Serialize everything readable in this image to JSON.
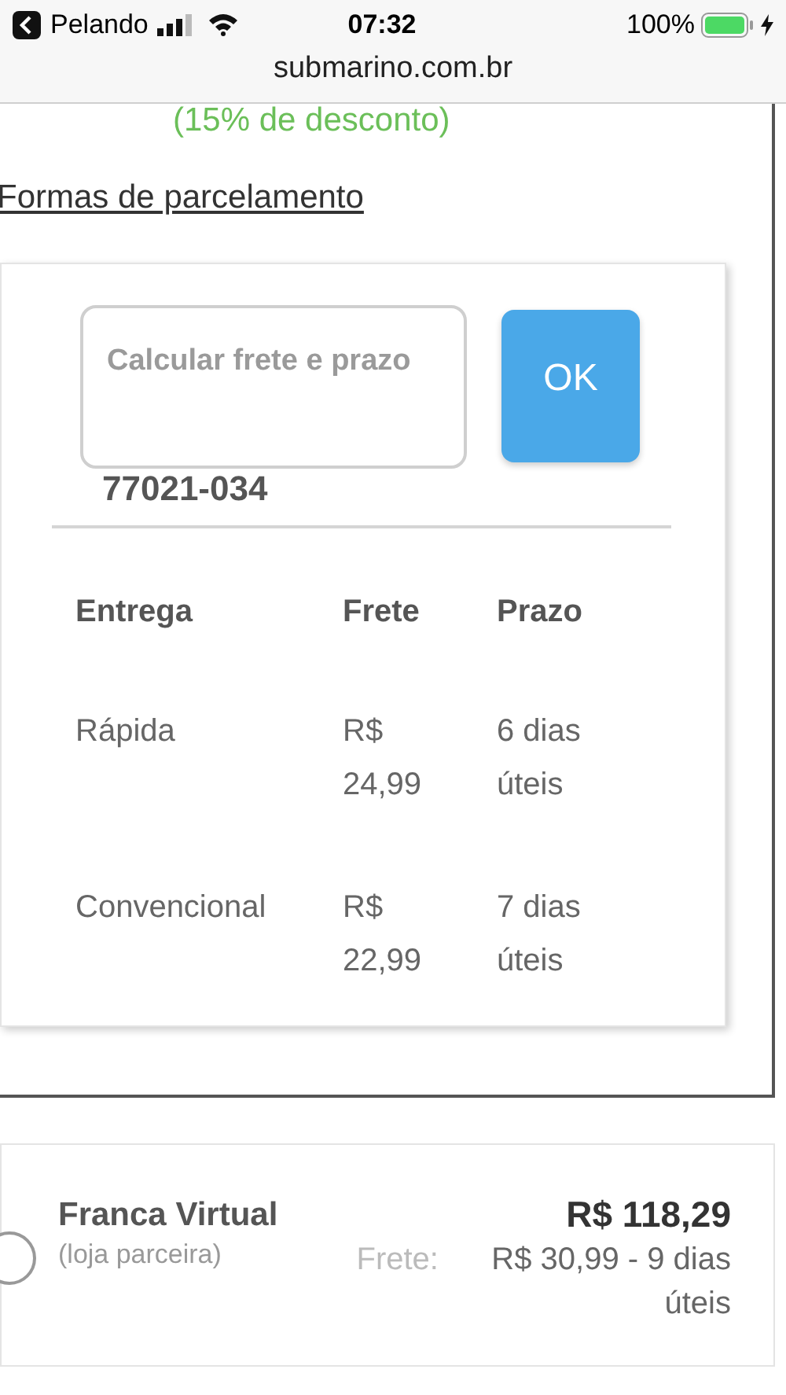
{
  "status_bar": {
    "back_app": "Pelando",
    "time": "07:32",
    "battery": "100%"
  },
  "browser": {
    "url": "submarino.com.br"
  },
  "discount": "(15% de desconto)",
  "installments_link": "Formas de parcelamento",
  "shipping": {
    "field": {
      "placeholder": "Calcular frete e prazo",
      "value": "77021-034"
    },
    "button": "OK",
    "table": {
      "columns": [
        "Entrega",
        "Frete",
        "Prazo"
      ],
      "rows": [
        [
          "Rápida",
          "R$ 24,99",
          "6 dias úteis"
        ],
        [
          "Convencional",
          "R$ 22,99",
          "7 dias úteis"
        ]
      ]
    }
  },
  "seller": {
    "selected": false,
    "name": "Franca Virtual",
    "note": "(loja parceira)",
    "price": "R$ 118,29",
    "freight_label": "Frete:",
    "freight": "R$ 30,99 - 9 dias úteis"
  }
}
